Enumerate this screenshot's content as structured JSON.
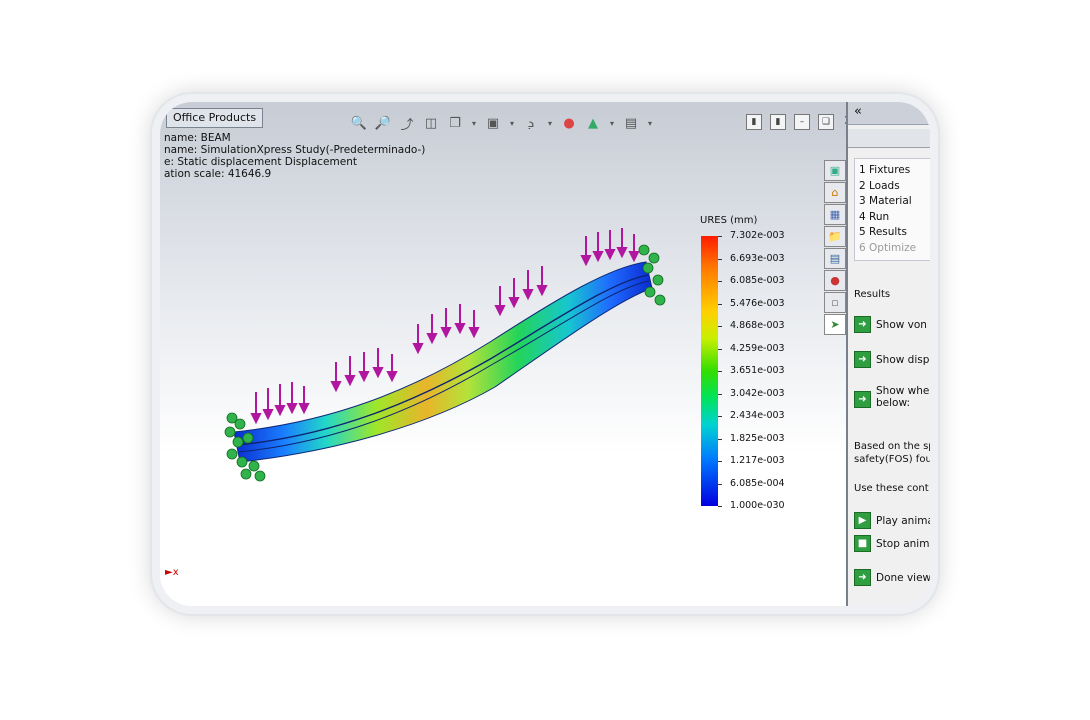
{
  "window": {
    "office_tab": "Office Products",
    "info_lines": [
      "name: BEAM",
      "name: SimulationXpress Study(-Predeterminado-)",
      "e: Static displacement Displacement",
      "ation scale: 41646.9"
    ]
  },
  "toolbar": {
    "icons": [
      "zoom-to-fit-icon",
      "zoom-area-icon",
      "previous-view-icon",
      "section-view-icon",
      "view-orientation-icon",
      "display-style-icon",
      "hide-show-icon",
      "edit-appearance-icon",
      "apply-scene-icon",
      "view-settings-icon"
    ]
  },
  "legend": {
    "title": "URES (mm)",
    "labels": [
      "7.302e-003",
      "6.693e-003",
      "6.085e-003",
      "5.476e-003",
      "4.868e-003",
      "4.259e-003",
      "3.651e-003",
      "3.042e-003",
      "2.434e-003",
      "1.825e-003",
      "1.217e-003",
      "6.085e-004",
      "1.000e-030"
    ],
    "colors": {
      "max": "#ff1c00",
      "mid": "#33dd00",
      "min": "#0000e0"
    }
  },
  "panel": {
    "collapse": "«",
    "steps": [
      "1 Fixtures",
      "2 Loads",
      "3 Material",
      "4 Run",
      "5 Results",
      "6 Optimize"
    ],
    "results_heading": "Results",
    "btn_von": "Show von",
    "btn_disp": "Show disp",
    "btn_where_1": "Show whe",
    "btn_where_2": "below:",
    "based_1": "Based on the sp",
    "based_2": "safety(FOS) fou",
    "use_these": "Use these cont",
    "play": "Play anima",
    "stop": "Stop anima",
    "done": "Done view"
  }
}
